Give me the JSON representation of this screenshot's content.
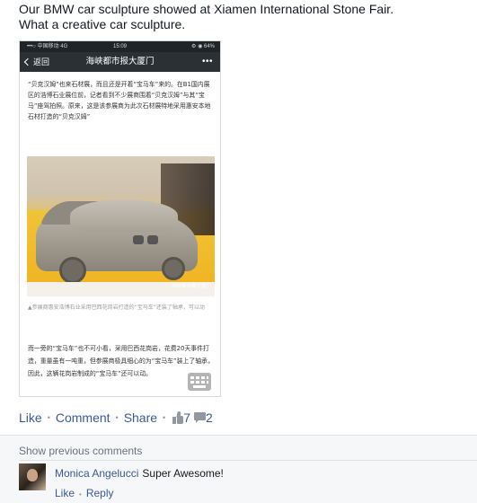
{
  "post": {
    "line1": "Our BMW car sculpture showed at Xiamen International Stone Fair.",
    "line2": "What a creative car sculpture."
  },
  "phone": {
    "status": {
      "carrier": "•••○ 中国移动  4G",
      "time": "15:09",
      "battery": "⚙ ◉ 64%"
    },
    "nav": {
      "back_label": "返回",
      "title": "海峡都市报大厦门",
      "more": "•••"
    },
    "para1": "“贝克汉姆”也来石材展，而且还是开着“宝马车”来的。在B1国内展区的浩博石业展位前，记者看到不少展商围着“贝克汉姆”与其“宝马”座驾拍照。原来，这是该参展商为此次石材展特地采用惠安本地石材打造的“贝克汉姆”",
    "photo_watermark": "海峡都市报大厦门",
    "caption": "▲参展商惠安浩博石业采用巴西花岗岩打造的“宝马车”还装了轴承，可以动",
    "para2": "而一旁的“宝马车”也不可小看，采用巴西花岗岩，花费20天事件打造，重量虽有一吨重，但参展商极具细心的为“宝马车”装上了轴承，因此，这辆花岗岩制成的“宝马车”还可以动。"
  },
  "actions": {
    "like": "Like",
    "comment": "Comment",
    "share": "Share",
    "dot": "•",
    "like_count": "7",
    "comment_count": "2"
  },
  "comments": {
    "show_previous": "Show previous comments",
    "items": [
      {
        "author": "Monica Angelucci",
        "text": "Super Awesome!",
        "like": "Like",
        "reply": "Reply"
      }
    ]
  },
  "colors": {
    "link": "#3b5998",
    "meta": "#9197a3",
    "bg_comments": "#f6f7f8"
  }
}
